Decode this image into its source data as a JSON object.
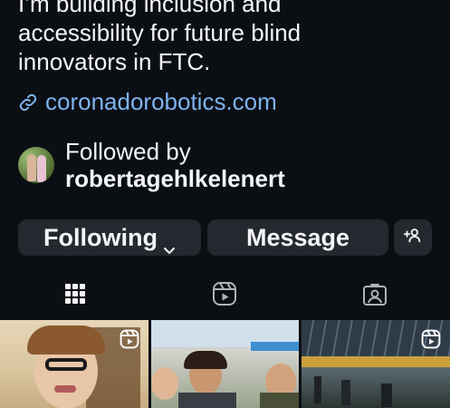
{
  "profile": {
    "bio_lines": [
      "I’m building inclusion and",
      "accessibility for future blind",
      "innovators in FTC."
    ],
    "link": "coronadorobotics.com",
    "followed_by_label": "Followed by",
    "followed_by_user": "robertagehlkelenert"
  },
  "actions": {
    "following_label": "Following",
    "message_label": "Message",
    "add_person_icon": "add-person-icon"
  },
  "tabs": {
    "icons": [
      "grid-icon",
      "reels-icon",
      "tagged-icon"
    ]
  },
  "posts": {
    "items": [
      {
        "type": "reel"
      },
      {
        "type": "photo"
      },
      {
        "type": "reel"
      }
    ]
  },
  "colors": {
    "background": "#0b0f14",
    "button_bg": "#25292f",
    "link": "#7fb2f0",
    "text": "#f2f4f7"
  }
}
